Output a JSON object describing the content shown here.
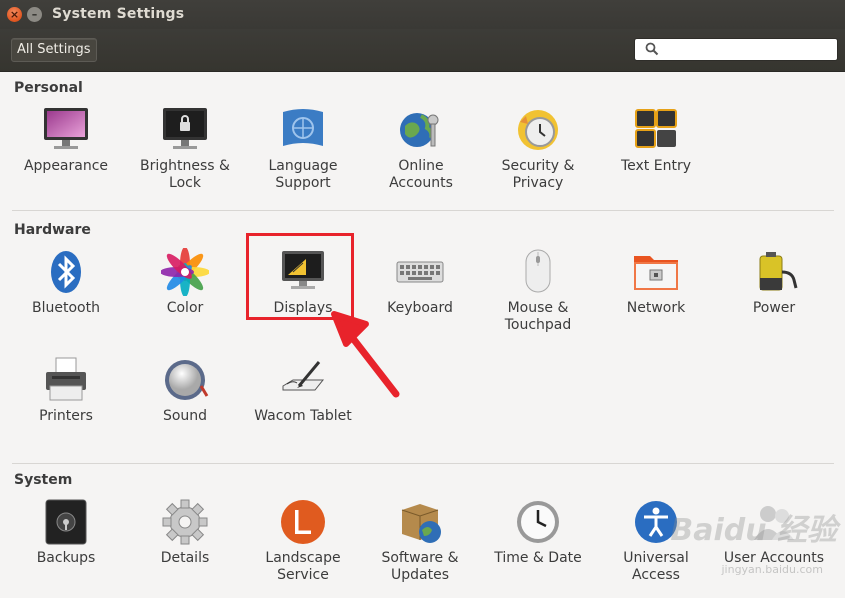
{
  "window": {
    "title": "System Settings"
  },
  "toolbar": {
    "all_settings": "All Settings",
    "search_placeholder": ""
  },
  "sections": {
    "personal": {
      "title": "Personal",
      "items": [
        "Appearance",
        "Brightness &\nLock",
        "Language\nSupport",
        "Online\nAccounts",
        "Security &\nPrivacy",
        "Text Entry"
      ]
    },
    "hardware": {
      "title": "Hardware",
      "items": [
        "Bluetooth",
        "Color",
        "Displays",
        "Keyboard",
        "Mouse &\nTouchpad",
        "Network",
        "Power",
        "Printers",
        "Sound",
        "Wacom Tablet"
      ]
    },
    "system": {
      "title": "System",
      "items": [
        "Backups",
        "Details",
        "Landscape\nService",
        "Software &\nUpdates",
        "Time & Date",
        "Universal\nAccess",
        "User Accounts"
      ]
    }
  },
  "annotation": {
    "highlighted_item": "Displays",
    "color": "#e8232b"
  },
  "watermark": {
    "brand": "Baidu 经验",
    "url": "jingyan.baidu.com"
  },
  "colors": {
    "titlebar": "#3c3b37",
    "close_button": "#e95420",
    "accent": "#e8232b"
  }
}
